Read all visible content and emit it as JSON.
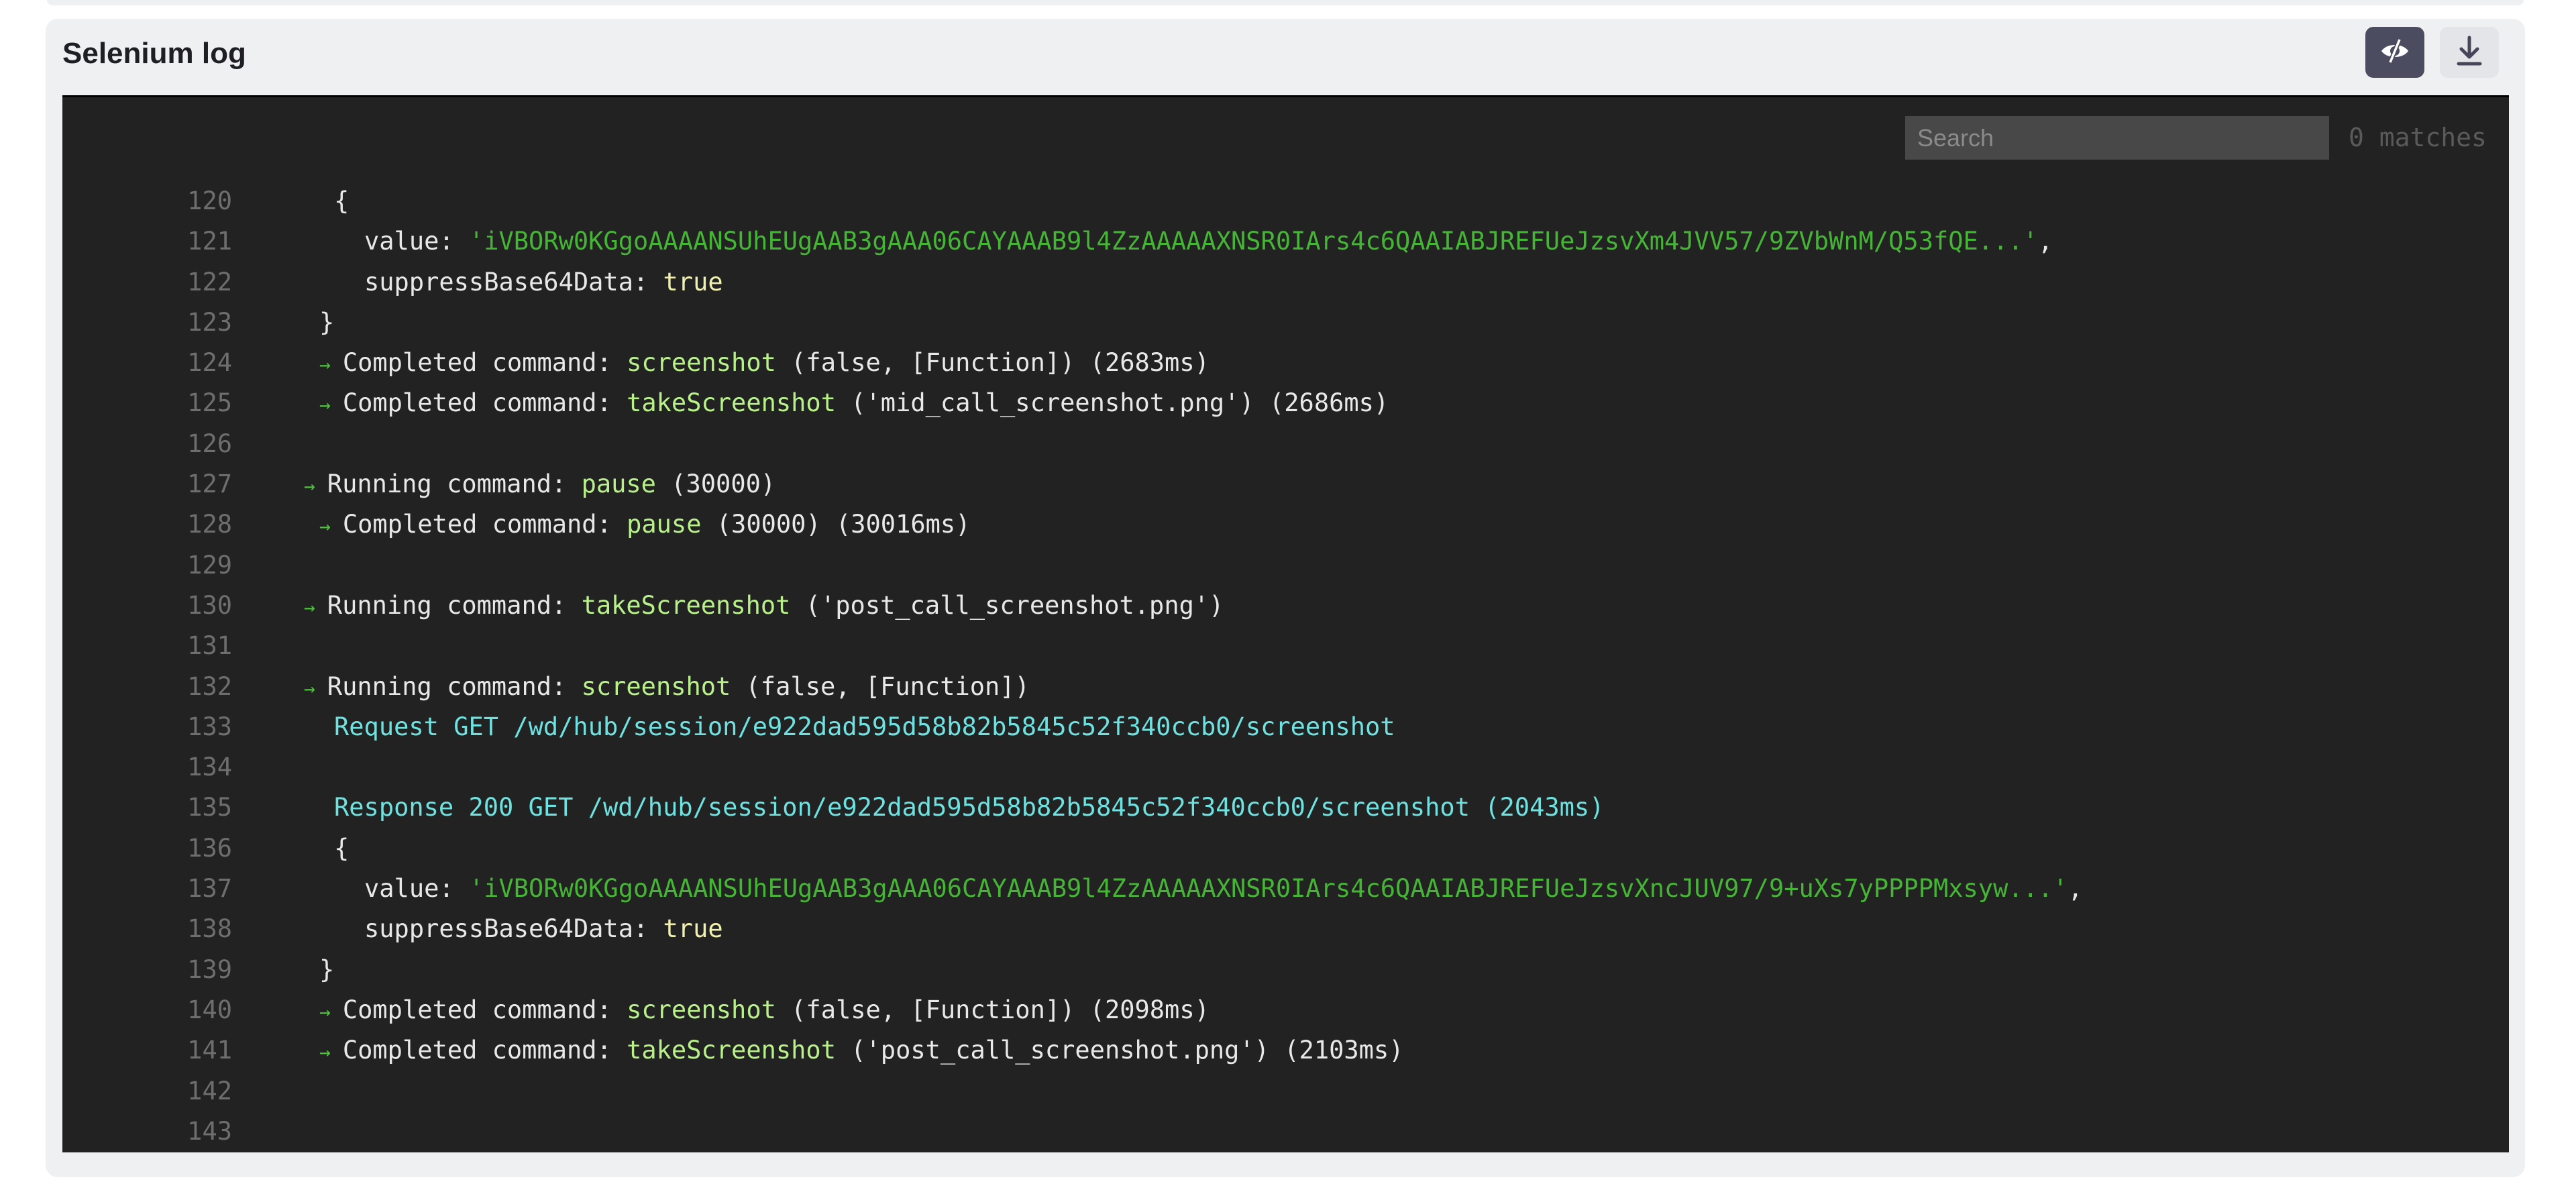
{
  "panel": {
    "title": "Selenium log",
    "buttons": {
      "toggle_visibility": {
        "icon": "eye-off-icon",
        "active": true
      },
      "download": {
        "icon": "download-icon"
      }
    },
    "search": {
      "placeholder": "Search",
      "value": "",
      "match_count": "0 matches"
    }
  },
  "colors": {
    "card_bg": "#eff0f2",
    "log_bg": "#222222",
    "command_name": "#b8f08a",
    "string_value": "#45b535",
    "keyword": "#f0f0b0",
    "network": "#6ee2e0",
    "arrow": "#4cc53a",
    "line_number": "#6e6e6e",
    "active_button": "#4b4c60"
  },
  "lines": [
    {
      "n": "120",
      "indent": 2,
      "parts": [
        {
          "t": "{",
          "c": "plain"
        }
      ]
    },
    {
      "n": "121",
      "indent": 3,
      "parts": [
        {
          "t": "value: ",
          "c": "plain"
        },
        {
          "t": "'iVBORw0KGgoAAAANSUhEUgAAB3gAAA06CAYAAAB9l4ZzAAAAAXNSR0IArs4c6QAAIABJREFUeJzsvXm4JVV57/9ZVbWnM/Q53fQE...'",
          "c": "str"
        },
        {
          "t": ",",
          "c": "plain"
        }
      ]
    },
    {
      "n": "122",
      "indent": 3,
      "parts": [
        {
          "t": "suppressBase64Data: ",
          "c": "plain"
        },
        {
          "t": "true",
          "c": "kw"
        }
      ]
    },
    {
      "n": "123",
      "indent": 1,
      "parts": [
        {
          "t": "}",
          "c": "plain"
        }
      ]
    },
    {
      "n": "124",
      "indent": 1,
      "arrow": true,
      "parts": [
        {
          "t": "Completed command: ",
          "c": "plain"
        },
        {
          "t": "screenshot",
          "c": "cmd"
        },
        {
          "t": " (false, [Function]) (2683ms)",
          "c": "plain"
        }
      ]
    },
    {
      "n": "125",
      "indent": 1,
      "arrow": true,
      "parts": [
        {
          "t": "Completed command: ",
          "c": "plain"
        },
        {
          "t": "takeScreenshot",
          "c": "cmd"
        },
        {
          "t": " ('mid_call_screenshot.png') (2686ms)",
          "c": "plain"
        }
      ]
    },
    {
      "n": "126",
      "indent": 0,
      "parts": []
    },
    {
      "n": "127",
      "indent": 0,
      "arrow": true,
      "parts": [
        {
          "t": "Running command: ",
          "c": "plain"
        },
        {
          "t": "pause",
          "c": "cmd"
        },
        {
          "t": " (30000)",
          "c": "plain"
        }
      ]
    },
    {
      "n": "128",
      "indent": 1,
      "arrow": true,
      "parts": [
        {
          "t": "Completed command: ",
          "c": "plain"
        },
        {
          "t": "pause",
          "c": "cmd"
        },
        {
          "t": " (30000) (30016ms)",
          "c": "plain"
        }
      ]
    },
    {
      "n": "129",
      "indent": 0,
      "parts": []
    },
    {
      "n": "130",
      "indent": 0,
      "arrow": true,
      "parts": [
        {
          "t": "Running command: ",
          "c": "plain"
        },
        {
          "t": "takeScreenshot",
          "c": "cmd"
        },
        {
          "t": " ('post_call_screenshot.png')",
          "c": "plain"
        }
      ]
    },
    {
      "n": "131",
      "indent": 0,
      "parts": []
    },
    {
      "n": "132",
      "indent": 0,
      "arrow": true,
      "parts": [
        {
          "t": "Running command: ",
          "c": "plain"
        },
        {
          "t": "screenshot",
          "c": "cmd"
        },
        {
          "t": " (false, [Function])",
          "c": "plain"
        }
      ]
    },
    {
      "n": "133",
      "indent": 2,
      "parts": [
        {
          "t": "Request GET /wd/hub/session/e922dad595d58b82b5845c52f340ccb0/screenshot",
          "c": "net"
        }
      ]
    },
    {
      "n": "134",
      "indent": 0,
      "parts": []
    },
    {
      "n": "135",
      "indent": 2,
      "parts": [
        {
          "t": "Response 200 GET /wd/hub/session/e922dad595d58b82b5845c52f340ccb0/screenshot (2043ms)",
          "c": "net"
        }
      ]
    },
    {
      "n": "136",
      "indent": 2,
      "parts": [
        {
          "t": "{",
          "c": "plain"
        }
      ]
    },
    {
      "n": "137",
      "indent": 3,
      "parts": [
        {
          "t": "value: ",
          "c": "plain"
        },
        {
          "t": "'iVBORw0KGgoAAAANSUhEUgAAB3gAAA06CAYAAAB9l4ZzAAAAAXNSR0IArs4c6QAAIABJREFUeJzsvXncJUV97/9+uXs7yPPPPMxsyw...'",
          "c": "str"
        },
        {
          "t": ",",
          "c": "plain"
        }
      ]
    },
    {
      "n": "138",
      "indent": 3,
      "parts": [
        {
          "t": "suppressBase64Data: ",
          "c": "plain"
        },
        {
          "t": "true",
          "c": "kw"
        }
      ]
    },
    {
      "n": "139",
      "indent": 1,
      "parts": [
        {
          "t": "}",
          "c": "plain"
        }
      ]
    },
    {
      "n": "140",
      "indent": 1,
      "arrow": true,
      "parts": [
        {
          "t": "Completed command: ",
          "c": "plain"
        },
        {
          "t": "screenshot",
          "c": "cmd"
        },
        {
          "t": " (false, [Function]) (2098ms)",
          "c": "plain"
        }
      ]
    },
    {
      "n": "141",
      "indent": 1,
      "arrow": true,
      "parts": [
        {
          "t": "Completed command: ",
          "c": "plain"
        },
        {
          "t": "takeScreenshot",
          "c": "cmd"
        },
        {
          "t": " ('post_call_screenshot.png') (2103ms)",
          "c": "plain"
        }
      ]
    },
    {
      "n": "142",
      "indent": 0,
      "parts": []
    },
    {
      "n": "143",
      "indent": 0,
      "parts": []
    }
  ]
}
